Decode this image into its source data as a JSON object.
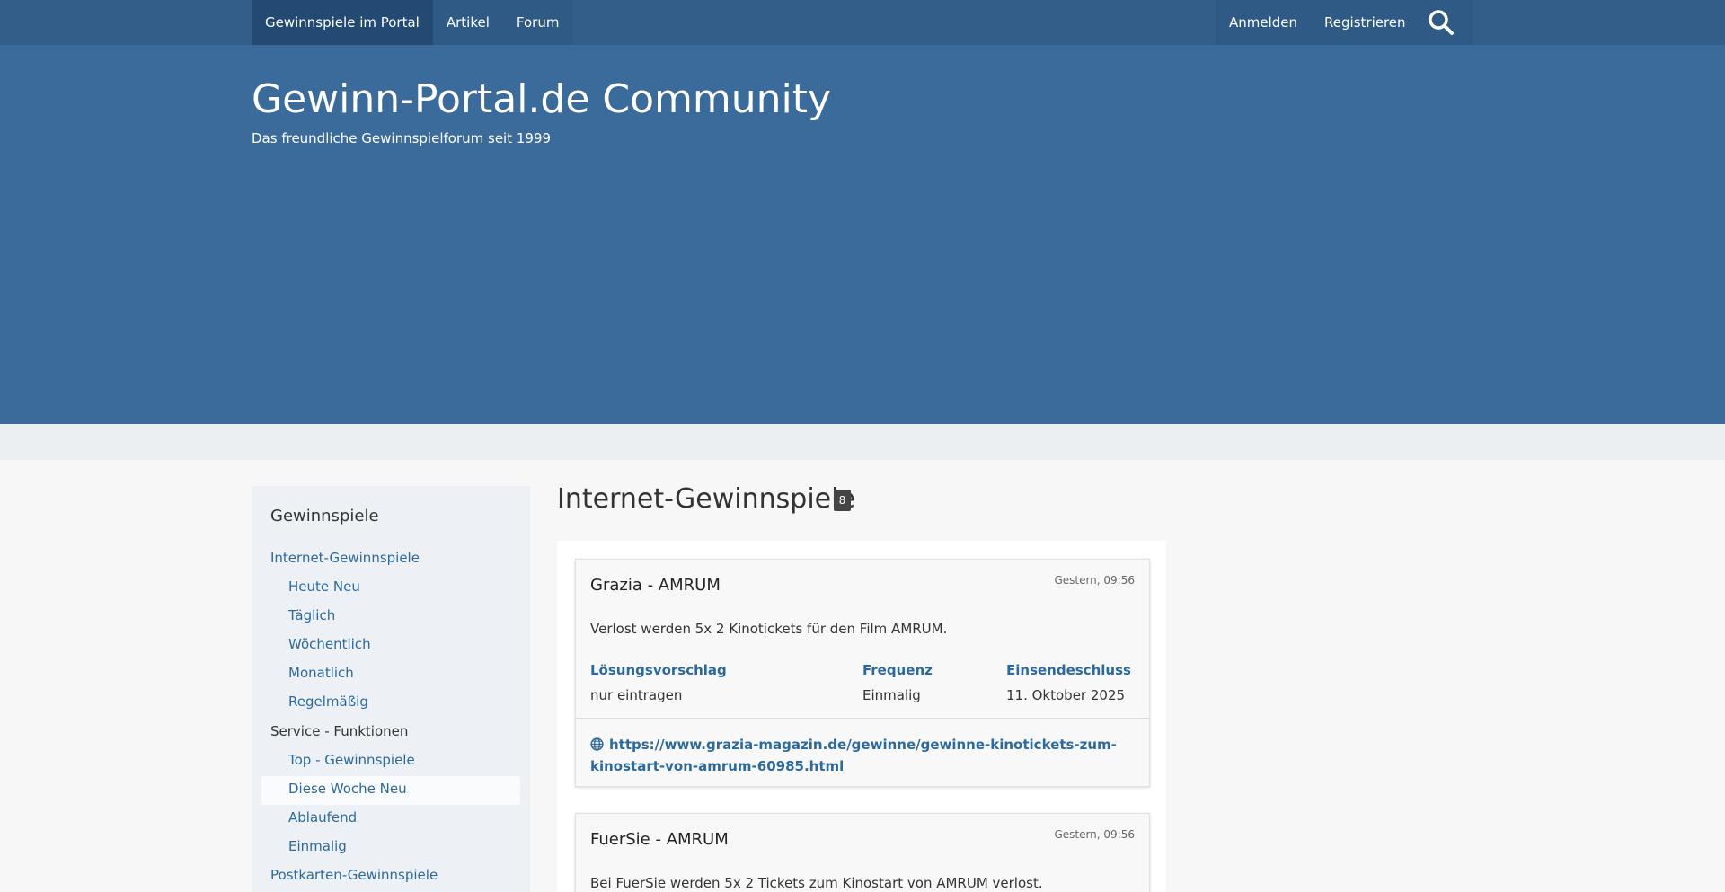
{
  "nav": {
    "left": [
      "Gewinnspiele im Portal",
      "Artikel",
      "Forum"
    ],
    "login": "Anmelden",
    "register": "Registrieren",
    "search_icon": "search-icon"
  },
  "header": {
    "title": "Gewinn-Portal.de Community",
    "subtitle": "Das freundliche Gewinnspielforum seit 1999"
  },
  "sidebar": {
    "title": "Gewinnspiele",
    "items": [
      {
        "label": "Internet-Gewinnspiele"
      },
      {
        "label": "Heute Neu"
      },
      {
        "label": "Täglich"
      },
      {
        "label": "Wöchentlich"
      },
      {
        "label": "Monatlich"
      },
      {
        "label": "Regelmäßig"
      },
      {
        "label": "Service - Funktionen"
      },
      {
        "label": "Top - Gewinnspiele"
      },
      {
        "label": "Diese Woche Neu"
      },
      {
        "label": "Ablaufend"
      },
      {
        "label": "Einmalig"
      },
      {
        "label": "Postkarten-Gewinnspiele"
      }
    ],
    "selected": "Diese Woche Neu"
  },
  "main": {
    "title": "Internet-Gewinnspiele",
    "count": "8",
    "cards": [
      {
        "title": "Grazia - AMRUM",
        "date": "Gestern, 09:56",
        "description": "Verlost werden 5x 2 Kinotickets für den Film AMRUM.",
        "labels": {
          "solution": "Lösungsvorschlag",
          "frequency": "Frequenz",
          "deadline": "Einsendeschluss"
        },
        "solution": "nur eintragen",
        "frequency": "Einmalig",
        "deadline": "11. Oktober 2025",
        "link": "https://www.grazia-magazin.de/gewinne/gewinne-kinotickets-zum-kinostart-von-amrum-60985.html",
        "link_icon": "globe-icon"
      },
      {
        "title": "FuerSie - AMRUM",
        "date": "Gestern, 09:56",
        "description": "Bei FuerSie werden 5x 2 Tickets zum Kinostart von AMRUM verlost."
      }
    ]
  },
  "colors": {
    "nav_bg": "#335e89",
    "header_bg": "#3b6b9a",
    "link": "#2d6a9c",
    "sidebar_bg": "#edf1f6"
  }
}
